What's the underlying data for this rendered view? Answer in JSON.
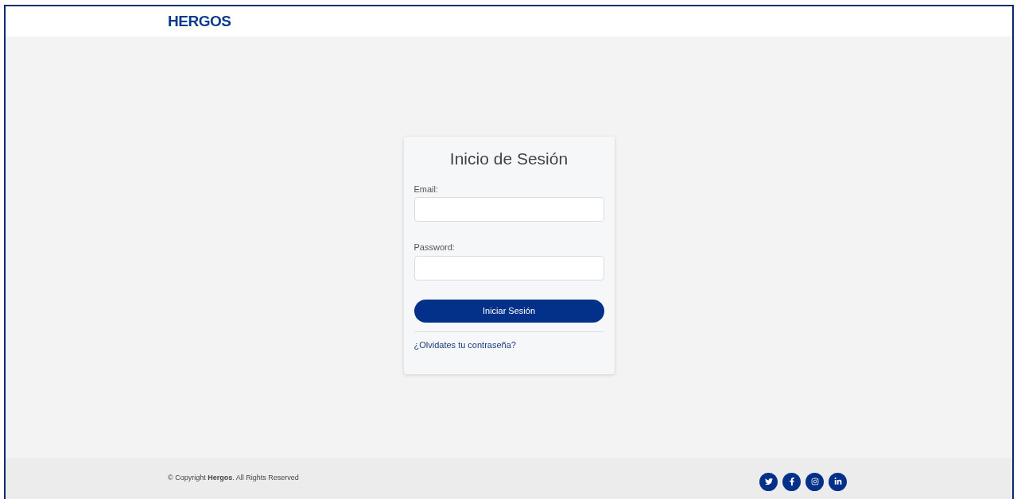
{
  "header": {
    "logo": "HERGOS"
  },
  "login": {
    "title": "Inicio de Sesión",
    "fields": [
      {
        "label": "Email:"
      },
      {
        "label": "Password:"
      }
    ],
    "submit": "Iniciar Sesión",
    "forgot_link": "¿Olvidates tu contraseña?"
  },
  "footer": {
    "copyright": "© Copyright **Hergos**. All Rights Reserved",
    "social": [
      {
        "kind": "twitter"
      },
      {
        "kind": "facebook"
      },
      {
        "kind": "instagram"
      },
      {
        "kind": "linkedin"
      }
    ]
  }
}
